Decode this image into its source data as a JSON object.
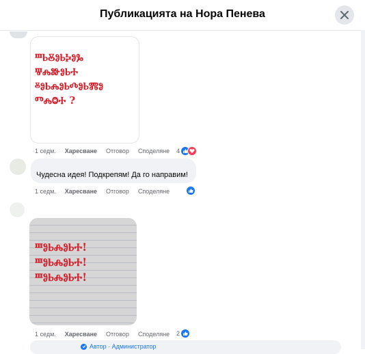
{
  "header": {
    "title": "Публикацията на Нора Пенева"
  },
  "comments": [
    {
      "image_lines": [
        "ⰞⰓⰋⰑⰓⰍⰑⰃ",
        "ⰛⰎⰖⰑⰓⰀ",
        "ⰻⰑⰓⰎⰑⰓⰄⰑⰓⰏⰑ",
        "ⰕⰎⰙⰀ ?"
      ],
      "time": "1 седм.",
      "like": "Харесване",
      "reply": "Отговор",
      "share": "Споделяне",
      "reaction_count": "4"
    },
    {
      "text": "Чудесна идея! Подкрепям! Да го направим!",
      "time": "1 седм.",
      "like": "Харесване",
      "reply": "Отговор",
      "share": "Споделяне",
      "reaction_count": ""
    },
    {
      "image_lines": [
        "ⰞⰑⰓⰎⰑⰓⰀ!",
        "ⰞⰑⰓⰎⰑⰓⰀ!",
        "ⰞⰑⰓⰎⰑⰓⰀ!"
      ],
      "time": "1 седм.",
      "like": "Харесване",
      "reply": "Отговор",
      "share": "Споделяне",
      "reaction_count": "2"
    }
  ],
  "next_comment": {
    "author_label": "Автор · Администратор"
  },
  "icons": {
    "close": "close-icon",
    "like": "like-icon",
    "love": "heart-icon",
    "verified": "verified-icon"
  },
  "colors": {
    "accent": "#1877f2",
    "glagolitic_ink": "#d8202b",
    "love": "#f33e58"
  }
}
